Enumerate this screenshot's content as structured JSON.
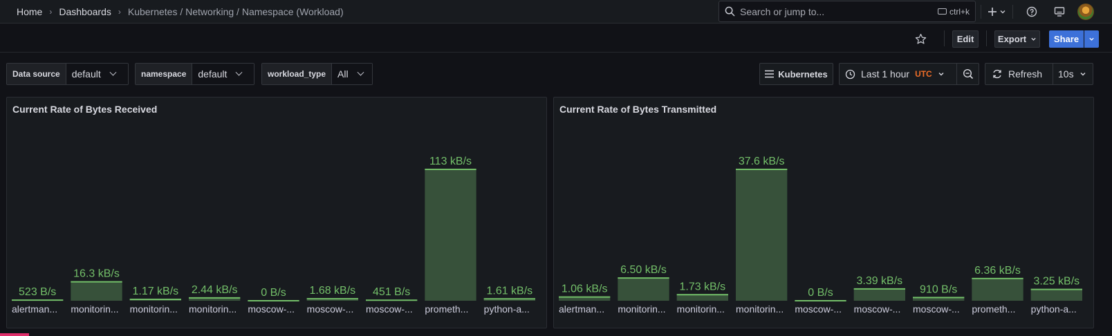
{
  "breadcrumb": {
    "home": "Home",
    "dashboards": "Dashboards",
    "current": "Kubernetes / Networking / Namespace (Workload)"
  },
  "search": {
    "placeholder": "Search or jump to...",
    "shortcut": "ctrl+k"
  },
  "toolbar": {
    "edit": "Edit",
    "export": "Export",
    "share": "Share"
  },
  "variables": [
    {
      "label": "Data source",
      "value": "default"
    },
    {
      "label": "namespace",
      "value": "default"
    },
    {
      "label": "workload_type",
      "value": "All"
    }
  ],
  "controls": {
    "kubernetes_link": "Kubernetes",
    "time_range": "Last 1 hour",
    "timezone": "UTC",
    "refresh": "Refresh",
    "refresh_interval": "10s"
  },
  "colors": {
    "bar_fill": "#37513a",
    "bar_line": "#73bf69",
    "accent_orange": "#f26f28",
    "primary_blue": "#3d71d9"
  },
  "panels": [
    {
      "title": "Current Rate of Bytes Received",
      "chart_data": {
        "type": "bar",
        "unit": "B/s",
        "categories": [
          "alertman...",
          "monitorin...",
          "monitorin...",
          "monitorin...",
          "moscow-...",
          "moscow-...",
          "moscow-...",
          "prometh...",
          "python-a..."
        ],
        "values": [
          523,
          16300,
          1170,
          2440,
          0,
          1680,
          451,
          113000,
          1610
        ],
        "labels": [
          "523 B/s",
          "16.3 kB/s",
          "1.17 kB/s",
          "2.44 kB/s",
          "0 B/s",
          "1.68 kB/s",
          "451 B/s",
          "113 kB/s",
          "1.61 kB/s"
        ],
        "ylim": [
          0,
          113000
        ]
      }
    },
    {
      "title": "Current Rate of Bytes Transmitted",
      "chart_data": {
        "type": "bar",
        "unit": "B/s",
        "categories": [
          "alertman...",
          "monitorin...",
          "monitorin...",
          "monitorin...",
          "moscow-...",
          "moscow-...",
          "moscow-...",
          "prometh...",
          "python-a..."
        ],
        "values": [
          1060,
          6500,
          1730,
          37600,
          0,
          3390,
          910,
          6360,
          3250
        ],
        "labels": [
          "1.06 kB/s",
          "6.50 kB/s",
          "1.73 kB/s",
          "37.6 kB/s",
          "0 B/s",
          "3.39 kB/s",
          "910 B/s",
          "6.36 kB/s",
          "3.25 kB/s"
        ],
        "ylim": [
          0,
          37600
        ]
      }
    }
  ]
}
